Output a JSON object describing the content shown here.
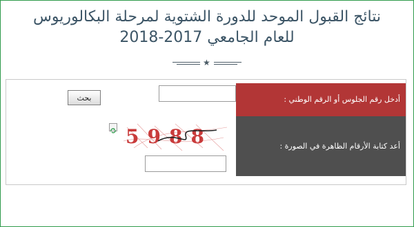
{
  "title": {
    "line1": "نتائج القبول الموحد للدورة الشتوية لمرحلة البكالوريوس",
    "line2": "للعام الجامعي 2017-2018"
  },
  "form": {
    "id_label": "أدخل رقم الجلوس أو الرقم الوطني :",
    "search_button": "بحث",
    "captcha_label": "أعد كتابة الأرقام الظاهرة في الصورة :",
    "captcha_text": "5988"
  },
  "colors": {
    "accent_red": "#b23636",
    "label_dark": "#4f4f4f",
    "frame_green": "#2e9a4b",
    "title_text": "#3c5566"
  },
  "icons": [
    "star-icon",
    "refresh-icon"
  ]
}
